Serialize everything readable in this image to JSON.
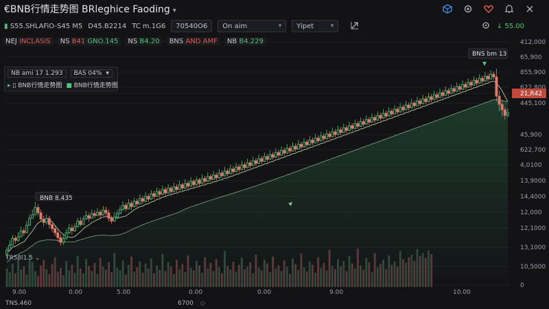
{
  "window": {
    "title": "€BNB行情走势图 BRleghice Faoding",
    "icons": [
      "cube-icon",
      "settings-icon",
      "heart-icon",
      "bell-icon",
      "close-icon"
    ]
  },
  "toolbar": {
    "ticker_text": "S55.SHLAFiO-S45 M5",
    "ticker_extra": "D45.B2214",
    "tc_text": "TC m.1G6",
    "select_symbol": "70540O6",
    "select_mode": "On aim",
    "select_type": "Yipet",
    "price": "55.00"
  },
  "legend": [
    {
      "label": "NEJ",
      "value": "INCLASIS",
      "color": "red"
    },
    {
      "label": "NS",
      "value": "B41",
      "extra": "GNO.145",
      "color": "green"
    },
    {
      "label": "NS",
      "value": "B4.20",
      "color": "green"
    },
    {
      "label": "BNS",
      "value": "AND AMF",
      "color": "red"
    },
    {
      "label": "NB",
      "value": "B4.229",
      "color": "green"
    }
  ],
  "indicator_box": {
    "row1_left": "NB ami 17 1.293",
    "row1_right": "BAS 04%",
    "row2_a": "BNB行情走势图",
    "row2_b": "BNB行情走势图"
  },
  "volume_label": "TR58l1.5",
  "bottom_left_label": "TNS.460",
  "bottom_mid_label": "6700",
  "chart_data": {
    "type": "candlestick",
    "y_ticks": [
      "412,000",
      "65,900",
      "855,900",
      "622,800",
      "21,R42",
      "445,100",
      "45,900",
      "622,700",
      "4,0100",
      "13,9000",
      "14,4000",
      "12,000",
      "12,1000",
      "13,1000",
      "10,5000",
      "0"
    ],
    "highlight_tick": "21,R42",
    "x_ticks": [
      "9.00",
      "0.00",
      "5.00",
      "0.00",
      "0.00",
      "9.00",
      "10.00"
    ],
    "annotations": [
      {
        "text": "BNB 8.435"
      },
      {
        "text": "BNS bm 13"
      }
    ],
    "up_color": "#4cc47a",
    "down_color": "#e07a6a",
    "candles": [
      [
        370,
        364,
        376,
        360
      ],
      [
        364,
        357,
        362,
        350
      ],
      [
        357,
        347,
        351,
        342
      ],
      [
        347,
        350,
        355,
        343
      ],
      [
        350,
        345,
        352,
        338
      ],
      [
        345,
        336,
        342,
        330
      ],
      [
        336,
        339,
        344,
        332
      ],
      [
        339,
        328,
        332,
        322
      ],
      [
        328,
        318,
        323,
        312
      ],
      [
        318,
        313,
        318,
        305
      ],
      [
        313,
        302,
        307,
        294
      ],
      [
        302,
        310,
        314,
        297
      ],
      [
        310,
        319,
        323,
        305
      ],
      [
        319,
        324,
        330,
        314
      ],
      [
        324,
        318,
        327,
        312
      ],
      [
        318,
        327,
        333,
        314
      ],
      [
        327,
        333,
        338,
        322
      ],
      [
        333,
        339,
        344,
        328
      ],
      [
        339,
        346,
        352,
        334
      ],
      [
        346,
        353,
        358,
        341
      ],
      [
        353,
        347,
        357,
        341
      ],
      [
        347,
        339,
        349,
        334
      ],
      [
        339,
        332,
        341,
        326
      ],
      [
        332,
        336,
        342,
        327
      ],
      [
        336,
        330,
        338,
        325
      ],
      [
        330,
        322,
        331,
        317
      ],
      [
        322,
        327,
        330,
        316
      ],
      [
        327,
        319,
        325,
        314
      ],
      [
        319,
        314,
        320,
        307
      ],
      [
        314,
        318,
        323,
        310
      ],
      [
        318,
        311,
        318,
        305
      ],
      [
        311,
        314,
        318,
        306
      ],
      [
        314,
        309,
        315,
        303
      ],
      [
        309,
        313,
        318,
        305
      ],
      [
        313,
        306,
        314,
        300
      ],
      [
        306,
        310,
        316,
        301
      ],
      [
        310,
        318,
        323,
        305
      ],
      [
        318,
        322,
        326,
        314
      ],
      [
        322,
        316,
        323,
        309
      ],
      [
        316,
        311,
        318,
        306
      ],
      [
        311,
        305,
        312,
        300
      ],
      [
        305,
        299,
        307,
        293
      ],
      [
        299,
        304,
        308,
        295
      ],
      [
        304,
        296,
        305,
        290
      ],
      [
        296,
        301,
        306,
        292
      ],
      [
        301,
        293,
        302,
        288
      ],
      [
        293,
        297,
        302,
        289
      ],
      [
        297,
        289,
        298,
        283
      ],
      [
        289,
        293,
        297,
        285
      ],
      [
        293,
        286,
        295,
        280
      ],
      [
        286,
        290,
        294,
        282
      ],
      [
        290,
        282,
        291,
        277
      ],
      [
        282,
        286,
        290,
        278
      ],
      [
        286,
        279,
        287,
        273
      ],
      [
        279,
        283,
        288,
        275
      ],
      [
        283,
        276,
        284,
        270
      ],
      [
        276,
        281,
        285,
        272
      ],
      [
        281,
        274,
        282,
        268
      ],
      [
        274,
        279,
        283,
        271
      ],
      [
        279,
        272,
        280,
        266
      ],
      [
        272,
        276,
        280,
        268
      ],
      [
        276,
        269,
        277,
        263
      ],
      [
        269,
        274,
        278,
        266
      ],
      [
        274,
        267,
        275,
        261
      ],
      [
        267,
        271,
        275,
        263
      ],
      [
        271,
        264,
        272,
        258
      ],
      [
        264,
        269,
        273,
        261
      ],
      [
        269,
        262,
        270,
        257
      ],
      [
        262,
        267,
        271,
        259
      ],
      [
        267,
        260,
        268,
        254
      ],
      [
        260,
        264,
        268,
        256
      ],
      [
        264,
        257,
        265,
        251
      ],
      [
        257,
        261,
        265,
        253
      ],
      [
        261,
        255,
        262,
        249
      ],
      [
        255,
        259,
        263,
        251
      ],
      [
        259,
        252,
        260,
        246
      ],
      [
        252,
        256,
        260,
        248
      ],
      [
        256,
        249,
        257,
        243
      ],
      [
        249,
        253,
        257,
        245
      ],
      [
        253,
        246,
        254,
        240
      ],
      [
        246,
        250,
        254,
        242
      ],
      [
        250,
        243,
        251,
        237
      ],
      [
        243,
        247,
        251,
        239
      ],
      [
        247,
        240,
        248,
        234
      ],
      [
        240,
        244,
        248,
        236
      ],
      [
        244,
        237,
        245,
        231
      ],
      [
        237,
        241,
        245,
        233
      ],
      [
        241,
        234,
        242,
        228
      ],
      [
        234,
        238,
        242,
        230
      ],
      [
        238,
        231,
        239,
        225
      ],
      [
        231,
        235,
        239,
        227
      ],
      [
        235,
        228,
        236,
        222
      ],
      [
        228,
        232,
        236,
        224
      ],
      [
        232,
        225,
        233,
        219
      ],
      [
        225,
        229,
        233,
        221
      ],
      [
        229,
        222,
        230,
        216
      ],
      [
        222,
        226,
        230,
        218
      ],
      [
        226,
        219,
        227,
        213
      ],
      [
        219,
        223,
        227,
        215
      ],
      [
        223,
        216,
        224,
        210
      ],
      [
        216,
        220,
        224,
        212
      ],
      [
        220,
        213,
        221,
        207
      ],
      [
        213,
        217,
        221,
        209
      ],
      [
        217,
        210,
        218,
        204
      ],
      [
        210,
        214,
        218,
        206
      ],
      [
        214,
        207,
        215,
        201
      ],
      [
        207,
        211,
        215,
        203
      ],
      [
        211,
        204,
        212,
        198
      ],
      [
        204,
        208,
        212,
        200
      ],
      [
        208,
        201,
        209,
        195
      ],
      [
        201,
        205,
        209,
        197
      ],
      [
        205,
        198,
        206,
        192
      ],
      [
        198,
        202,
        206,
        194
      ],
      [
        202,
        195,
        203,
        189
      ],
      [
        195,
        199,
        203,
        191
      ],
      [
        199,
        192,
        200,
        186
      ],
      [
        192,
        196,
        200,
        188
      ],
      [
        196,
        189,
        197,
        183
      ],
      [
        189,
        193,
        197,
        185
      ],
      [
        193,
        186,
        194,
        180
      ],
      [
        186,
        190,
        194,
        182
      ],
      [
        190,
        183,
        191,
        177
      ],
      [
        183,
        187,
        191,
        179
      ],
      [
        187,
        180,
        188,
        174
      ],
      [
        180,
        184,
        188,
        176
      ],
      [
        184,
        177,
        185,
        171
      ],
      [
        177,
        181,
        185,
        173
      ],
      [
        181,
        174,
        182,
        168
      ],
      [
        174,
        178,
        182,
        170
      ],
      [
        178,
        171,
        179,
        165
      ],
      [
        171,
        175,
        179,
        167
      ],
      [
        175,
        168,
        176,
        162
      ],
      [
        168,
        172,
        176,
        164
      ],
      [
        172,
        165,
        173,
        159
      ],
      [
        165,
        169,
        173,
        161
      ],
      [
        169,
        162,
        170,
        156
      ],
      [
        162,
        166,
        170,
        158
      ],
      [
        166,
        159,
        167,
        153
      ],
      [
        159,
        163,
        167,
        155
      ],
      [
        163,
        156,
        164,
        150
      ],
      [
        156,
        160,
        164,
        152
      ],
      [
        160,
        153,
        161,
        147
      ],
      [
        153,
        157,
        161,
        149
      ],
      [
        157,
        150,
        158,
        144
      ],
      [
        150,
        154,
        158,
        146
      ],
      [
        154,
        147,
        155,
        141
      ],
      [
        147,
        151,
        155,
        143
      ],
      [
        151,
        144,
        152,
        138
      ],
      [
        144,
        148,
        152,
        140
      ],
      [
        148,
        141,
        149,
        135
      ],
      [
        141,
        145,
        149,
        137
      ],
      [
        145,
        138,
        146,
        132
      ],
      [
        138,
        142,
        146,
        134
      ],
      [
        142,
        135,
        143,
        129
      ],
      [
        135,
        139,
        143,
        131
      ],
      [
        139,
        132,
        140,
        126
      ],
      [
        132,
        136,
        140,
        128
      ],
      [
        136,
        129,
        137,
        123
      ],
      [
        129,
        133,
        137,
        125
      ],
      [
        133,
        126,
        134,
        120
      ],
      [
        126,
        130,
        134,
        122
      ],
      [
        130,
        123,
        131,
        117
      ],
      [
        123,
        127,
        131,
        119
      ],
      [
        127,
        120,
        128,
        114
      ],
      [
        120,
        124,
        128,
        116
      ],
      [
        124,
        117,
        125,
        111
      ],
      [
        117,
        121,
        125,
        113
      ],
      [
        121,
        114,
        122,
        108
      ],
      [
        114,
        118,
        122,
        110
      ],
      [
        118,
        111,
        119,
        105
      ],
      [
        111,
        115,
        119,
        107
      ],
      [
        115,
        108,
        116,
        102
      ],
      [
        108,
        112,
        116,
        104
      ],
      [
        112,
        140,
        148,
        100
      ],
      [
        140,
        152,
        162,
        132
      ],
      [
        152,
        160,
        170,
        146
      ],
      [
        160,
        168,
        174,
        156
      ],
      [
        168,
        164,
        171,
        158
      ]
    ],
    "volumes": [
      30,
      24,
      38,
      22,
      46,
      28,
      33,
      20,
      52,
      41,
      26,
      18,
      35,
      44,
      29,
      21,
      37,
      48,
      25,
      31,
      19,
      42,
      27,
      36,
      23,
      50,
      30,
      22,
      45,
      34,
      26,
      39,
      21,
      47,
      33,
      28,
      40,
      24,
      55,
      31,
      27,
      43,
      20,
      36,
      49,
      25,
      32,
      41,
      23,
      38,
      30,
      46,
      22,
      35,
      28,
      53,
      26,
      40,
      33,
      21,
      44,
      29,
      37,
      24,
      51,
      31,
      27,
      42,
      35,
      23,
      48,
      30,
      39,
      26,
      45,
      32,
      22,
      58,
      34,
      28,
      41,
      25,
      36,
      47,
      29,
      33,
      40,
      22,
      52,
      31,
      27,
      44,
      38,
      24,
      49,
      30,
      35,
      26,
      43,
      33,
      21,
      46,
      37,
      28,
      54,
      32,
      25,
      41,
      36,
      23,
      48,
      31,
      39,
      27,
      60,
      34,
      29,
      45,
      33,
      42,
      26,
      50,
      38,
      30,
      62,
      35,
      28,
      47,
      40,
      24,
      55,
      32,
      37,
      44,
      29,
      51,
      36,
      41,
      33,
      58,
      45,
      39,
      48,
      52,
      42,
      61,
      50,
      55,
      47,
      59,
      53
    ]
  }
}
